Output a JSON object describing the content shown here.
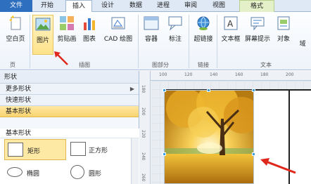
{
  "tabs": {
    "file": "文件",
    "items": [
      "开始",
      "插入",
      "设计",
      "数据",
      "进程",
      "审阅",
      "视图"
    ],
    "active": "插入",
    "context": "格式"
  },
  "ribbon": {
    "blank_page": "空白页",
    "picture": "图片",
    "clipart": "剪贴画",
    "chart": "图表",
    "cad": "CAD 绘图",
    "container": "容器",
    "callout": "标注",
    "hyperlink": "超链接",
    "textbox": "文本框",
    "screentip": "屏幕提示",
    "object": "对象",
    "field": "域",
    "groups": {
      "pages": "页",
      "illustrations": "插图",
      "diagram_parts": "图部分",
      "links": "链接",
      "text": "文本"
    }
  },
  "shapes_panel": {
    "title": "形状",
    "more_shapes": "更多形状",
    "quick_shapes": "快速形状",
    "basic_shapes": "基本形状",
    "stencil_title": "基本形状",
    "items": [
      "矩形",
      "正方形",
      "椭圆",
      "圆形"
    ]
  },
  "rulers": {
    "top": [
      "100",
      "120",
      "140",
      "160",
      "180",
      "200"
    ],
    "left": [
      "180",
      "200",
      "220",
      "240",
      "260"
    ]
  },
  "colors": {
    "file_tab": "#2f6fbf",
    "highlight": "#ffe28a",
    "arrow": "#e0271b",
    "selection_handle": "#39a1e8"
  },
  "icons": {
    "blank_page": "blank-page-icon",
    "picture": "picture-icon",
    "clipart": "clipart-icon",
    "chart": "chart-icon",
    "cad": "cad-drawing-icon",
    "container": "container-icon",
    "callout": "callout-icon",
    "hyperlink": "hyperlink-icon",
    "textbox": "textbox-icon",
    "screentip": "screentip-icon",
    "object": "object-icon"
  }
}
